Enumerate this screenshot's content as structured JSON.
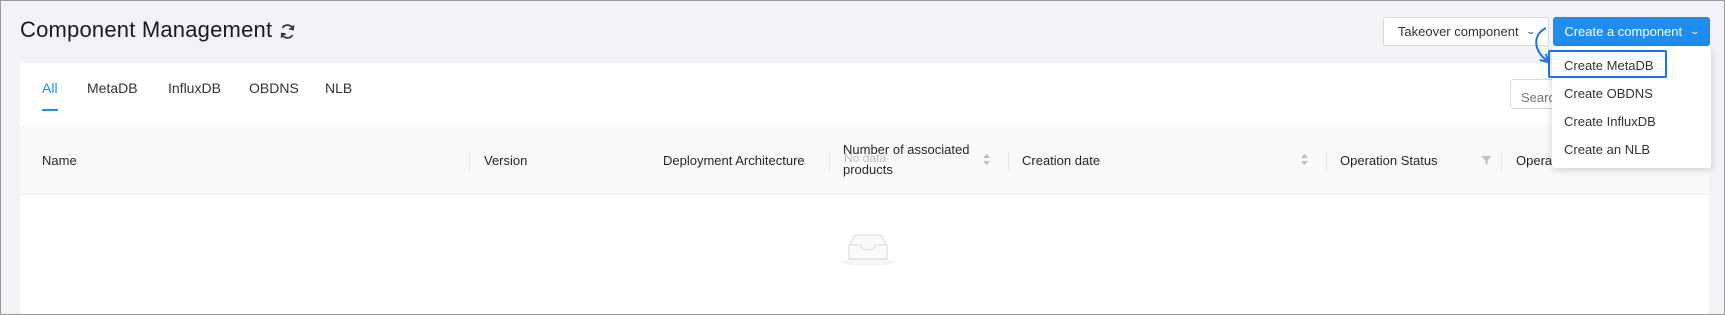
{
  "header": {
    "title": "Component Management",
    "takeover_label": "Takeover component",
    "create_label": "Create a component"
  },
  "tabs": [
    {
      "label": "All",
      "active": true
    },
    {
      "label": "MetaDB",
      "active": false
    },
    {
      "label": "InfluxDB",
      "active": false
    },
    {
      "label": "OBDNS",
      "active": false
    },
    {
      "label": "NLB",
      "active": false
    }
  ],
  "search": {
    "placeholder": "Search"
  },
  "table": {
    "columns": [
      {
        "label": "Name"
      },
      {
        "label": "Version"
      },
      {
        "label": "Deployment Architecture"
      },
      {
        "label": "Number of associated products",
        "sortable": true
      },
      {
        "label": "Creation date",
        "sortable": true
      },
      {
        "label": "Operation Status",
        "filterable": true
      },
      {
        "label": "Operation"
      }
    ],
    "rows": [],
    "empty_text": "No data"
  },
  "dropdown": {
    "items": [
      {
        "label": "Create MetaDB",
        "highlighted": true
      },
      {
        "label": "Create OBDNS"
      },
      {
        "label": "Create InfluxDB"
      },
      {
        "label": "Create an NLB"
      }
    ]
  },
  "colors": {
    "accent": "#1f8cf0",
    "annotation": "#1a73e8",
    "page_bg": "#f2f3f7"
  }
}
